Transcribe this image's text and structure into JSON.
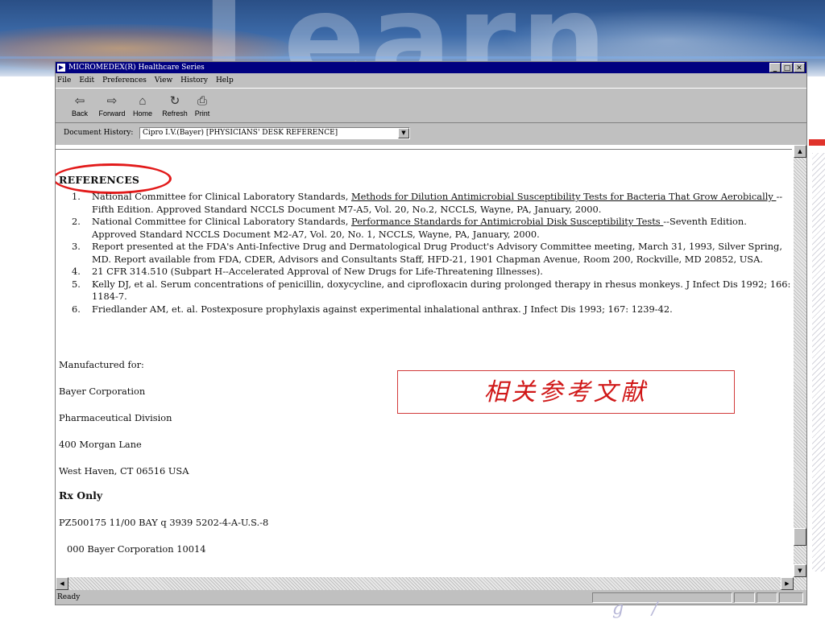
{
  "window": {
    "title": "MICROMEDEX(R) Healthcare Series",
    "controls": [
      "_",
      "□",
      "✕"
    ]
  },
  "menu": [
    "File",
    "Edit",
    "Preferences",
    "View",
    "History",
    "Help"
  ],
  "toolbar": [
    {
      "label": "Back",
      "icon": "back-arrow-icon"
    },
    {
      "label": "Forward",
      "icon": "forward-arrow-icon"
    },
    {
      "label": "Home",
      "icon": "home-icon"
    },
    {
      "label": "Refresh",
      "icon": "refresh-icon"
    },
    {
      "label": "Print",
      "icon": "print-icon"
    }
  ],
  "history": {
    "label": "Document History:",
    "value": "Cipro I.V.(Bayer) [PHYSICIANS' DESK REFERENCE]"
  },
  "document": {
    "heading": "REFERENCES",
    "references": [
      {
        "num": "1.",
        "before": "National Committee for Clinical Laboratory Standards, ",
        "link": " Methods for Dilution Antimicrobial Susceptibility Tests for Bacteria That Grow Aerobically ",
        "after": " --Fifth Edition. Approved Standard NCCLS Document M7-A5, Vol. 20, No.2, NCCLS, Wayne, PA, January, 2000."
      },
      {
        "num": "2.",
        "before": "National Committee for Clinical Laboratory Standards, ",
        "link": " Performance Standards for Antimicrobial Disk Susceptibility Tests ",
        "after": " --Seventh Edition. Approved Standard NCCLS Document M2-A7, Vol. 20, No. 1, NCCLS, Wayne, PA, January, 2000."
      },
      {
        "num": "3.",
        "before": "Report presented at the FDA's Anti-Infective Drug and Dermatological Drug Product's Advisory Committee meeting, March 31, 1993, Silver Spring, MD. Report available from FDA, CDER, Advisors and Consultants Staff, HFD-21, 1901 Chapman Avenue, Room 200, Rockville, MD 20852, USA.",
        "link": "",
        "after": ""
      },
      {
        "num": "4.",
        "before": "21 CFR 314.510 (Subpart H--Accelerated Approval of New Drugs for Life-Threatening Illnesses).",
        "link": "",
        "after": ""
      },
      {
        "num": "5.",
        "before": "Kelly DJ, et al. Serum concentrations of penicillin, doxycycline, and ciprofloxacin during prolonged therapy in rhesus monkeys. J Infect Dis 1992; 166: 1184-7.",
        "link": "",
        "after": ""
      },
      {
        "num": "6.",
        "before": "Friedlander AM, et. al. Postexposure prophylaxis against experimental inhalational anthrax. J Infect Dis 1993; 167: 1239-42.",
        "link": "",
        "after": ""
      }
    ],
    "manufactured_for": "Manufactured for:",
    "company": "Bayer Corporation",
    "division": "Pharmaceutical Division",
    "street": "400 Morgan Lane",
    "city": "West Haven, CT 06516 USA",
    "rx": "Rx Only",
    "code": "PZ500175 11/00 BAY q 3939 5202-4-A-U.S.-8",
    "copyright": "000 Bayer Corporation 10014"
  },
  "annotation": "相关参考文献",
  "status": "Ready",
  "colors": {
    "titlebar": "#000080",
    "annotation_red": "#d01818",
    "circle_red": "#e21a1a"
  }
}
